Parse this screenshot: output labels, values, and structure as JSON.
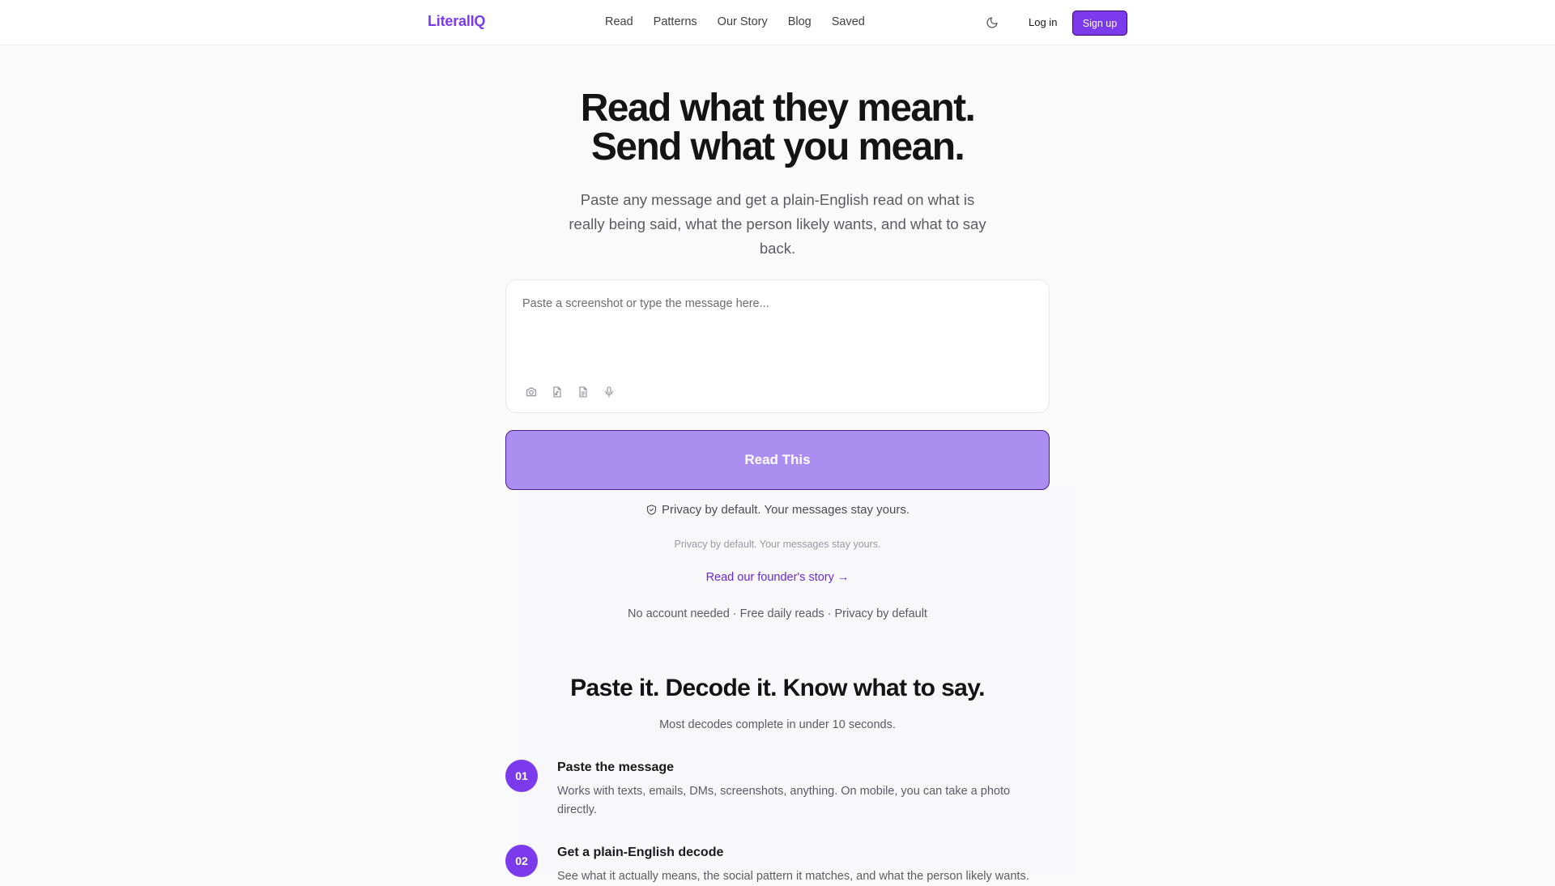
{
  "header": {
    "brand": "LiteralIQ",
    "nav": [
      "Read",
      "Patterns",
      "Our Story",
      "Blog",
      "Saved"
    ],
    "theme_toggle_icon": "moon-icon",
    "login_label": "Log in",
    "signup_label": "Sign up"
  },
  "hero": {
    "title_line1": "Read what they meant.",
    "title_line2": "Send what you mean.",
    "subtitle": "Paste any message and get a plain-English read on what is really being said, what the person likely wants, and what to say back."
  },
  "composer": {
    "placeholder": "Paste a screenshot or type the message here...",
    "value": "",
    "tools": [
      "camera-icon",
      "file-audio-icon",
      "document-icon",
      "microphone-icon"
    ]
  },
  "read_button_label": "Read This",
  "privacy_note": "Privacy by default. Your messages stay yours.",
  "privacy_note_small": "Privacy by default. Your messages stay yours.",
  "founder_link": "Read our founder's story →",
  "features_line": "No account needed · Free daily reads · Privacy by default",
  "how_it_works": {
    "title": "Paste it. Decode it. Know what to say.",
    "subtitle": "Most decodes complete in under 10 seconds.",
    "steps": [
      {
        "number": "01",
        "title": "Paste the message",
        "description": "Works with texts, emails, DMs, screenshots, anything. On mobile, you can take a photo directly."
      },
      {
        "number": "02",
        "title": "Get a plain-English decode",
        "description": "See what it actually means, the social pattern it matches, and what the person likely wants."
      }
    ]
  },
  "colors": {
    "brand": "#7c3aed",
    "read_button": "#ab8ff0",
    "link": "#6d28d9"
  }
}
